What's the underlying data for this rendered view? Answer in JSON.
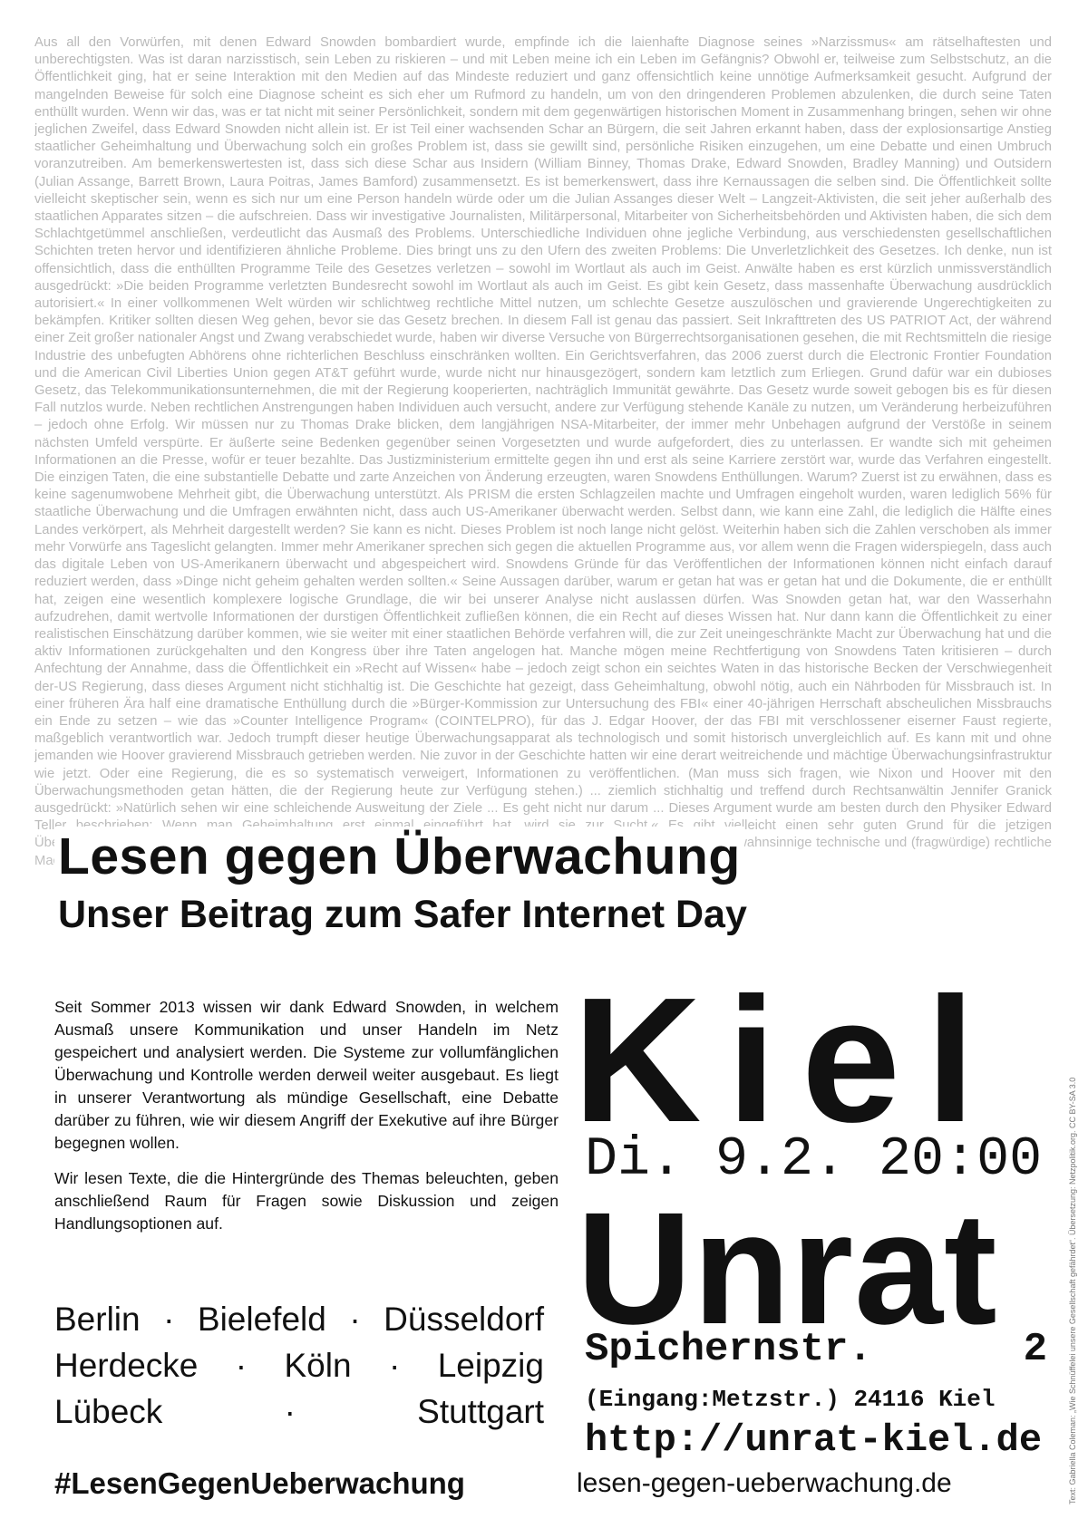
{
  "background_text": {
    "lines": [
      "Aus all den Vorwürfen, mit denen Edward Snowden bombardiert wurde, empfinde ich die laienhafte Diagnose seines »Narzissmus« am rätselhaftesten und unberechtigsten. Was ist daran narzisstisch, sein Leben zu riskieren – und mit Leben meine ich ein Leben im Gefängnis? Obwohl er, teilweise zum Selbstschutz, an die Öffentlichkeit ging, hat er seine Interaktion mit den Medien auf das Mindeste reduziert und ganz offensichtlich keine unnötige Aufmerksamkeit gesucht. Aufgrund der mangelnden Beweise für solch eine Diagnose scheint es sich eher um Rufmord zu handeln, um von den dringenderen Problemen abzulenken, die durch seine Taten enthüllt wurden. Wenn wir das, was er tat nicht mit seiner Persönlichkeit, sondern mit dem gegenwärtigen historischen Moment in Zusammenhang bringen, sehen wir ohne jeglichen Zweifel, dass Edward Snowden nicht allein ist. Er ist Teil einer wachsenden Schar an Bürgern, die seit Jahren erkannt haben, dass der explosionsartige Anstieg staatlicher Geheimhaltung und Überwachung solch ein großes Problem ist, dass sie gewillt sind, persönliche Risiken einzugehen, um eine Debatte und einen Umbruch voranzutreiben. Am bemerkenswertesten ist, dass sich diese Schar aus Insidern (William Binney, Thomas Drake, Edward Snowden, Bradley Manning) und Outsidern (Julian Assange, Barrett Brown, Laura Poitras, James Bamford) zusammensetzt. Es ist bemerkenswert, dass ihre Kernaussagen die selben sind. Die Öffentlichkeit sollte vielleicht skeptischer sein, wenn es sich nur um eine Person handeln würde oder um die Julian Assanges dieser Welt – Langzeit-Aktivisten, die seit jeher außerhalb des staatlichen Apparates sitzen – die aufschreien. Dass wir investigative Journalisten, Militärpersonal, Mitarbeiter von Sicherheitsbehörden und Aktivisten haben, die sich dem Schlachtgetümmel anschließen, verdeutlicht das Ausmaß des Problems. Unterschiedliche Individuen ohne jegliche Verbindung, aus verschiedensten gesellschaftlichen Schichten treten hervor und identifizieren ähnliche Probleme. Dies bringt uns zu den Ufern des zweiten Problems: Die Unverletzlichkeit des Gesetzes. Ich denke, nun ist offensichtlich, dass die enthüllten Programme Teile des Gesetzes verletzen – sowohl im Wortlaut als auch im Geist. Anwälte haben es erst kürzlich unmissverständlich ausgedrückt: »Die beiden Programme verletzten Bundesrecht sowohl im Wortlaut als auch im Geist. Es gibt kein Gesetz, dass massenhafte Überwachung ausdrücklich autorisiert.« In einer vollkommenen Welt würden wir schlichtweg rechtliche Mittel nutzen, um schlechte Gesetze auszulöschen und gravierende Ungerechtigkeiten zu bekämpfen. Kritiker sollten diesen Weg gehen, bevor sie das Gesetz brechen. In diesem Fall ist genau das passiert. Seit Inkrafttreten des US PATRIOT Act, der während einer Zeit großer nationaler Angst und Zwang verabschiedet wurde, haben wir diverse Versuche von Bürgerrechtsorganisationen gesehen, die mit Rechtsmitteln die riesige Industrie des unbefugten Abhörens ohne richterlichen Beschluss einschränken wollten. Ein Gerichtsverfahren, das 2006 zuerst durch die Electronic Frontier Foundation und die American Civil Liberties Union gegen AT&T geführt wurde, wurde nicht nur hinausgezögert, sondern kam letztlich zum Erliegen. Grund dafür war ein dubioses Gesetz, das Telekommunikationsunternehmen, die mit der Regierung kooperierten, nachträglich Immunität gewährte. Das Gesetz wurde soweit gebogen bis es für diesen Fall nutzlos wurde. Neben rechtlichen Anstrengungen haben Individuen auch versucht, andere zur Verfügung stehende Kanäle zu nutzen, um Veränderung herbeizuführen – jedoch ohne Erfolg. Wir müssen nur zu Thomas Drake blicken, dem langjährigen NSA-Mitarbeiter, der immer mehr Unbehagen aufgrund der Verstöße in seinem nächsten Umfeld verspürte. Er äußerte seine Bedenken gegenüber seinen Vorgesetzten und wurde aufgefordert, dies zu unterlassen. Er wandte sich mit geheimen Informationen an die Presse, wofür er teuer bezahlte. Das Justizministerium ermittelte gegen ihn und erst als seine Karriere zerstört war, wurde das Verfahren eingestellt. Die einzigen Taten, die eine substantielle Debatte und zarte Anzeichen von Änderung erzeugten, waren Snowdens Enthüllungen. Warum? Zuerst ist zu erwähnen, dass es keine sagenumwobene Mehrheit gibt, die Überwachung unterstützt. Als PRISM die ersten Schlagzeilen machte und Umfragen eingeholt wurden, waren lediglich 56% für staatliche Überwachung und die Umfragen erwähnten nicht, dass auch US-Amerikaner überwacht werden. Selbst dann, wie kann eine Zahl, die lediglich die Hälfte eines Landes verkörpert, als Mehrheit dargestellt werden? Sie kann es nicht. Dieses Problem ist noch lange nicht gelöst. Weiterhin haben sich die Zahlen verschoben als immer mehr Vorwürfe ans Tageslicht gelangten. Immer mehr Amerikaner sprechen sich gegen die aktuellen Programme aus, vor allem wenn die Fragen widerspiegeln, dass auch das digitale Leben von US-Amerikanern überwacht und abgespeichert wird. Snowdens Gründe für das Veröffentlichen der Informationen können nicht einfach darauf reduziert werden, dass »Dinge nicht geheim gehalten werden sollten.« Seine Aussagen darüber, warum er getan hat was er getan hat und die Dokumente, die er enthüllt hat, zeigen eine wesentlich komplexere logische Grundlage, die wir bei unserer Analyse nicht auslassen dürfen. Was Snowden getan hat, war den Wasserhahn aufzudrehen, damit wertvolle Informationen der durstigen Öffentlichkeit zufließen können, die ein Recht auf dieses Wissen hat. Nur dann kann die Öffentlichkeit zu einer realistischen Einschätzung darüber kommen, wie sie weiter mit einer staatlichen Behörde verfahren will, die zur Zeit uneingeschränkte Macht zur Überwachung hat und die aktiv Informationen zurückgehalten und den Kongress über ihre Taten angelogen hat. Manche mögen meine Rechtfertigung von Snowdens Taten kritisieren – durch Anfechtung der Annahme, dass die Öffentlichkeit ein »Recht auf Wissen« habe – jedoch zeigt schon ein seichtes Waten in das historische Becken der Verschwiegenheit der-US Regierung, dass dieses Argument nicht stichhaltig ist. Die Geschichte hat gezeigt, dass Geheimhaltung, obwohl nötig, auch ein Nährboden für Missbrauch ist. In einer früheren Ära half eine dramatische Enthüllung durch die »Bürger-Kommission zur Untersuchung des FBI« einer 40-jährigen Herrschaft abscheulichen Missbrauchs ein Ende zu setzen – wie das »Counter Intelligence Program« (COINTELPRO), für das J. Edgar Hoover, der das FBI mit verschlossener eiserner Faust regierte, maßgeblich verantwortlich war. Jedoch trumpft dieser heutige Überwachungsapparat als technologisch und somit historisch unvergleichlich auf. Es kann mit und ohne jemanden wie Hoover gravierend Missbrauch getrieben werden. Nie zuvor in der Geschichte hatten wir eine derart weitreichende und mächtige Überwachungsinfrastruktur wie jetzt. Oder eine Regierung, die es so systematisch verweigert, Informationen zu veröffentlichen. (Man muss sich fragen, wie Nixon und Hoover mit den Überwachungsmethoden getan hätten, die der Regierung heute zur Verfügung stehen.) ... ziemlich stichhaltig und treffend durch Rechtsanwältin Jennifer Granick ausgedrückt: »Natürlich sehen wir eine schleichende Ausweitung der Ziele ... Es geht nicht nur darum ... Dieses Argument wurde am besten durch den Physiker Edward Teller beschrieben: Wenn man Geheimhaltung erst einmal eingeführt hat, wird sie zur Sucht.« Es gibt vielleicht einen sehr guten Grund für die jetzigen Überwachungsmethoden der NSA, aber bis dieser Grund bekanntgegeben wird gibt es keinen Grund, dass sie solch wahnsinnige technische und (fragwürdige) rechtliche Macht besitzen, wie sie ihr zur Zeit zur Verfügung steht. Das Problem ..."
    ]
  },
  "headline": {
    "title": "Lesen gegen Überwachung",
    "subtitle": "Unser Beitrag zum Safer Internet Day"
  },
  "intro": {
    "paragraph1": "Seit Sommer 2013 wissen wir dank Edward Snowden, in welchem Ausmaß unsere Kommunikation und unser Handeln im Netz gespeichert und analysiert werden. Die Systeme zur vollumfänglichen Überwachung und Kontrolle werden derweil weiter ausgebaut. Es liegt in unserer Verantwortung als mündige Gesellschaft, eine Debatte darüber zu führen, wie wir diesem Angriff der Exekutive auf ihre Bürger begegnen wollen.",
    "paragraph2": "Wir lesen Texte, die die Hintergründe des Themas beleuchten, geben anschließend Raum für Fragen sowie Diskussion und zeigen Handlungsoptionen auf."
  },
  "cities": {
    "row1": [
      "Berlin",
      "·",
      "Bielefeld",
      "·",
      "Düsseldorf"
    ],
    "row2": [
      "Herdecke",
      "·",
      "Köln",
      "·",
      "Leipzig"
    ],
    "row3": [
      "Lübeck",
      "·",
      "Stuttgart"
    ]
  },
  "hashtag": "#LesenGegenUeberwachung",
  "event": {
    "city": "Kiel",
    "datetime": "Di. 9.2. 20:00",
    "venue": "Unrat",
    "street_name": "Spichernstr.",
    "street_number": "2",
    "entrance": "(Eingang:Metzstr.) 24116 Kiel",
    "venue_url": "http://unrat-kiel.de",
    "site_url": "lesen-gegen-ueberwachung.de"
  },
  "credit": "Text: Gabriella Coleman: „Wie Schnüffelei unsere Gesellschaft gefährdet“. Übersetzung: Netzpolitik.org. CC BY-SA 3.0"
}
